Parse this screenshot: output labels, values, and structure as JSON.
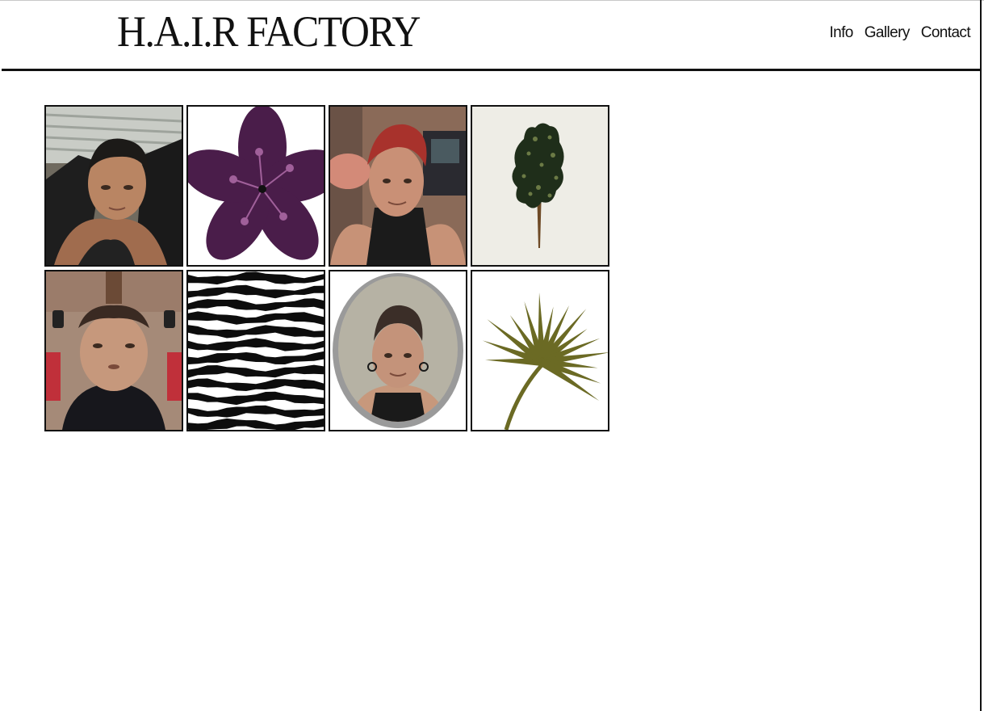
{
  "site": {
    "logo_text": "H.A.I.R FACTORY"
  },
  "nav": [
    {
      "label": "Info"
    },
    {
      "label": "Gallery"
    },
    {
      "label": "Contact"
    }
  ],
  "gallery": {
    "items": [
      {
        "subject": "portrait-photo-1"
      },
      {
        "subject": "purple-flower-illustration"
      },
      {
        "subject": "portrait-photo-red-hair"
      },
      {
        "subject": "tree-illustration"
      },
      {
        "subject": "mirrored-portrait-photo"
      },
      {
        "subject": "zebra-stripes-pattern"
      },
      {
        "subject": "oval-framed-portrait"
      },
      {
        "subject": "palm-leaf-illustration"
      }
    ]
  },
  "colors": {
    "flower": "#4a1d4a",
    "flower_dots": "#a0609a",
    "tree_foliage": "#1f2e1a",
    "tree_dots": "#6b7a45",
    "tree_trunk": "#6e4a26",
    "tree_bg": "#eeede6",
    "palm": "#6b6a24"
  }
}
